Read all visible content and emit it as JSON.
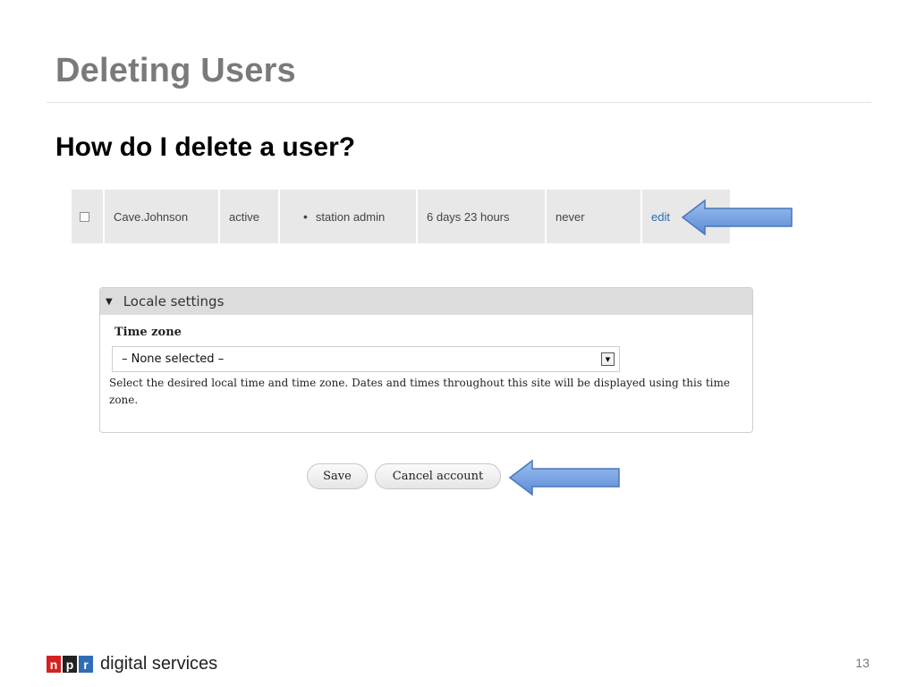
{
  "slide": {
    "title": "Deleting Users",
    "subtitle": "How do I delete a user?",
    "page_number": "13"
  },
  "user_row": {
    "username": "Cave.Johnson",
    "status": "active",
    "role": "station admin",
    "member_for": "6 days 23 hours",
    "last_access": "never",
    "edit_label": "edit",
    "checked": false
  },
  "locale": {
    "legend": "Locale settings",
    "timezone_label": "Time zone",
    "timezone_value": "– None selected –",
    "description": "Select the desired local time and time zone. Dates and times throughout this site will be displayed using this time zone."
  },
  "buttons": {
    "save_label": "Save",
    "cancel_label": "Cancel account"
  },
  "footer": {
    "logo_letters": [
      "n",
      "p",
      "r"
    ],
    "text": "digital services"
  },
  "colors": {
    "arrow_fill": "#6f9ee0",
    "link": "#2a6cb3",
    "logo_n": "#d62021",
    "logo_p": "#222222",
    "logo_r": "#2f6db5"
  },
  "icons": {
    "legend_caret": "caret-down-icon",
    "select_dropdown": "chevron-down-icon",
    "checkbox": "checkbox-icon",
    "arrows": "left-arrow-icon"
  }
}
